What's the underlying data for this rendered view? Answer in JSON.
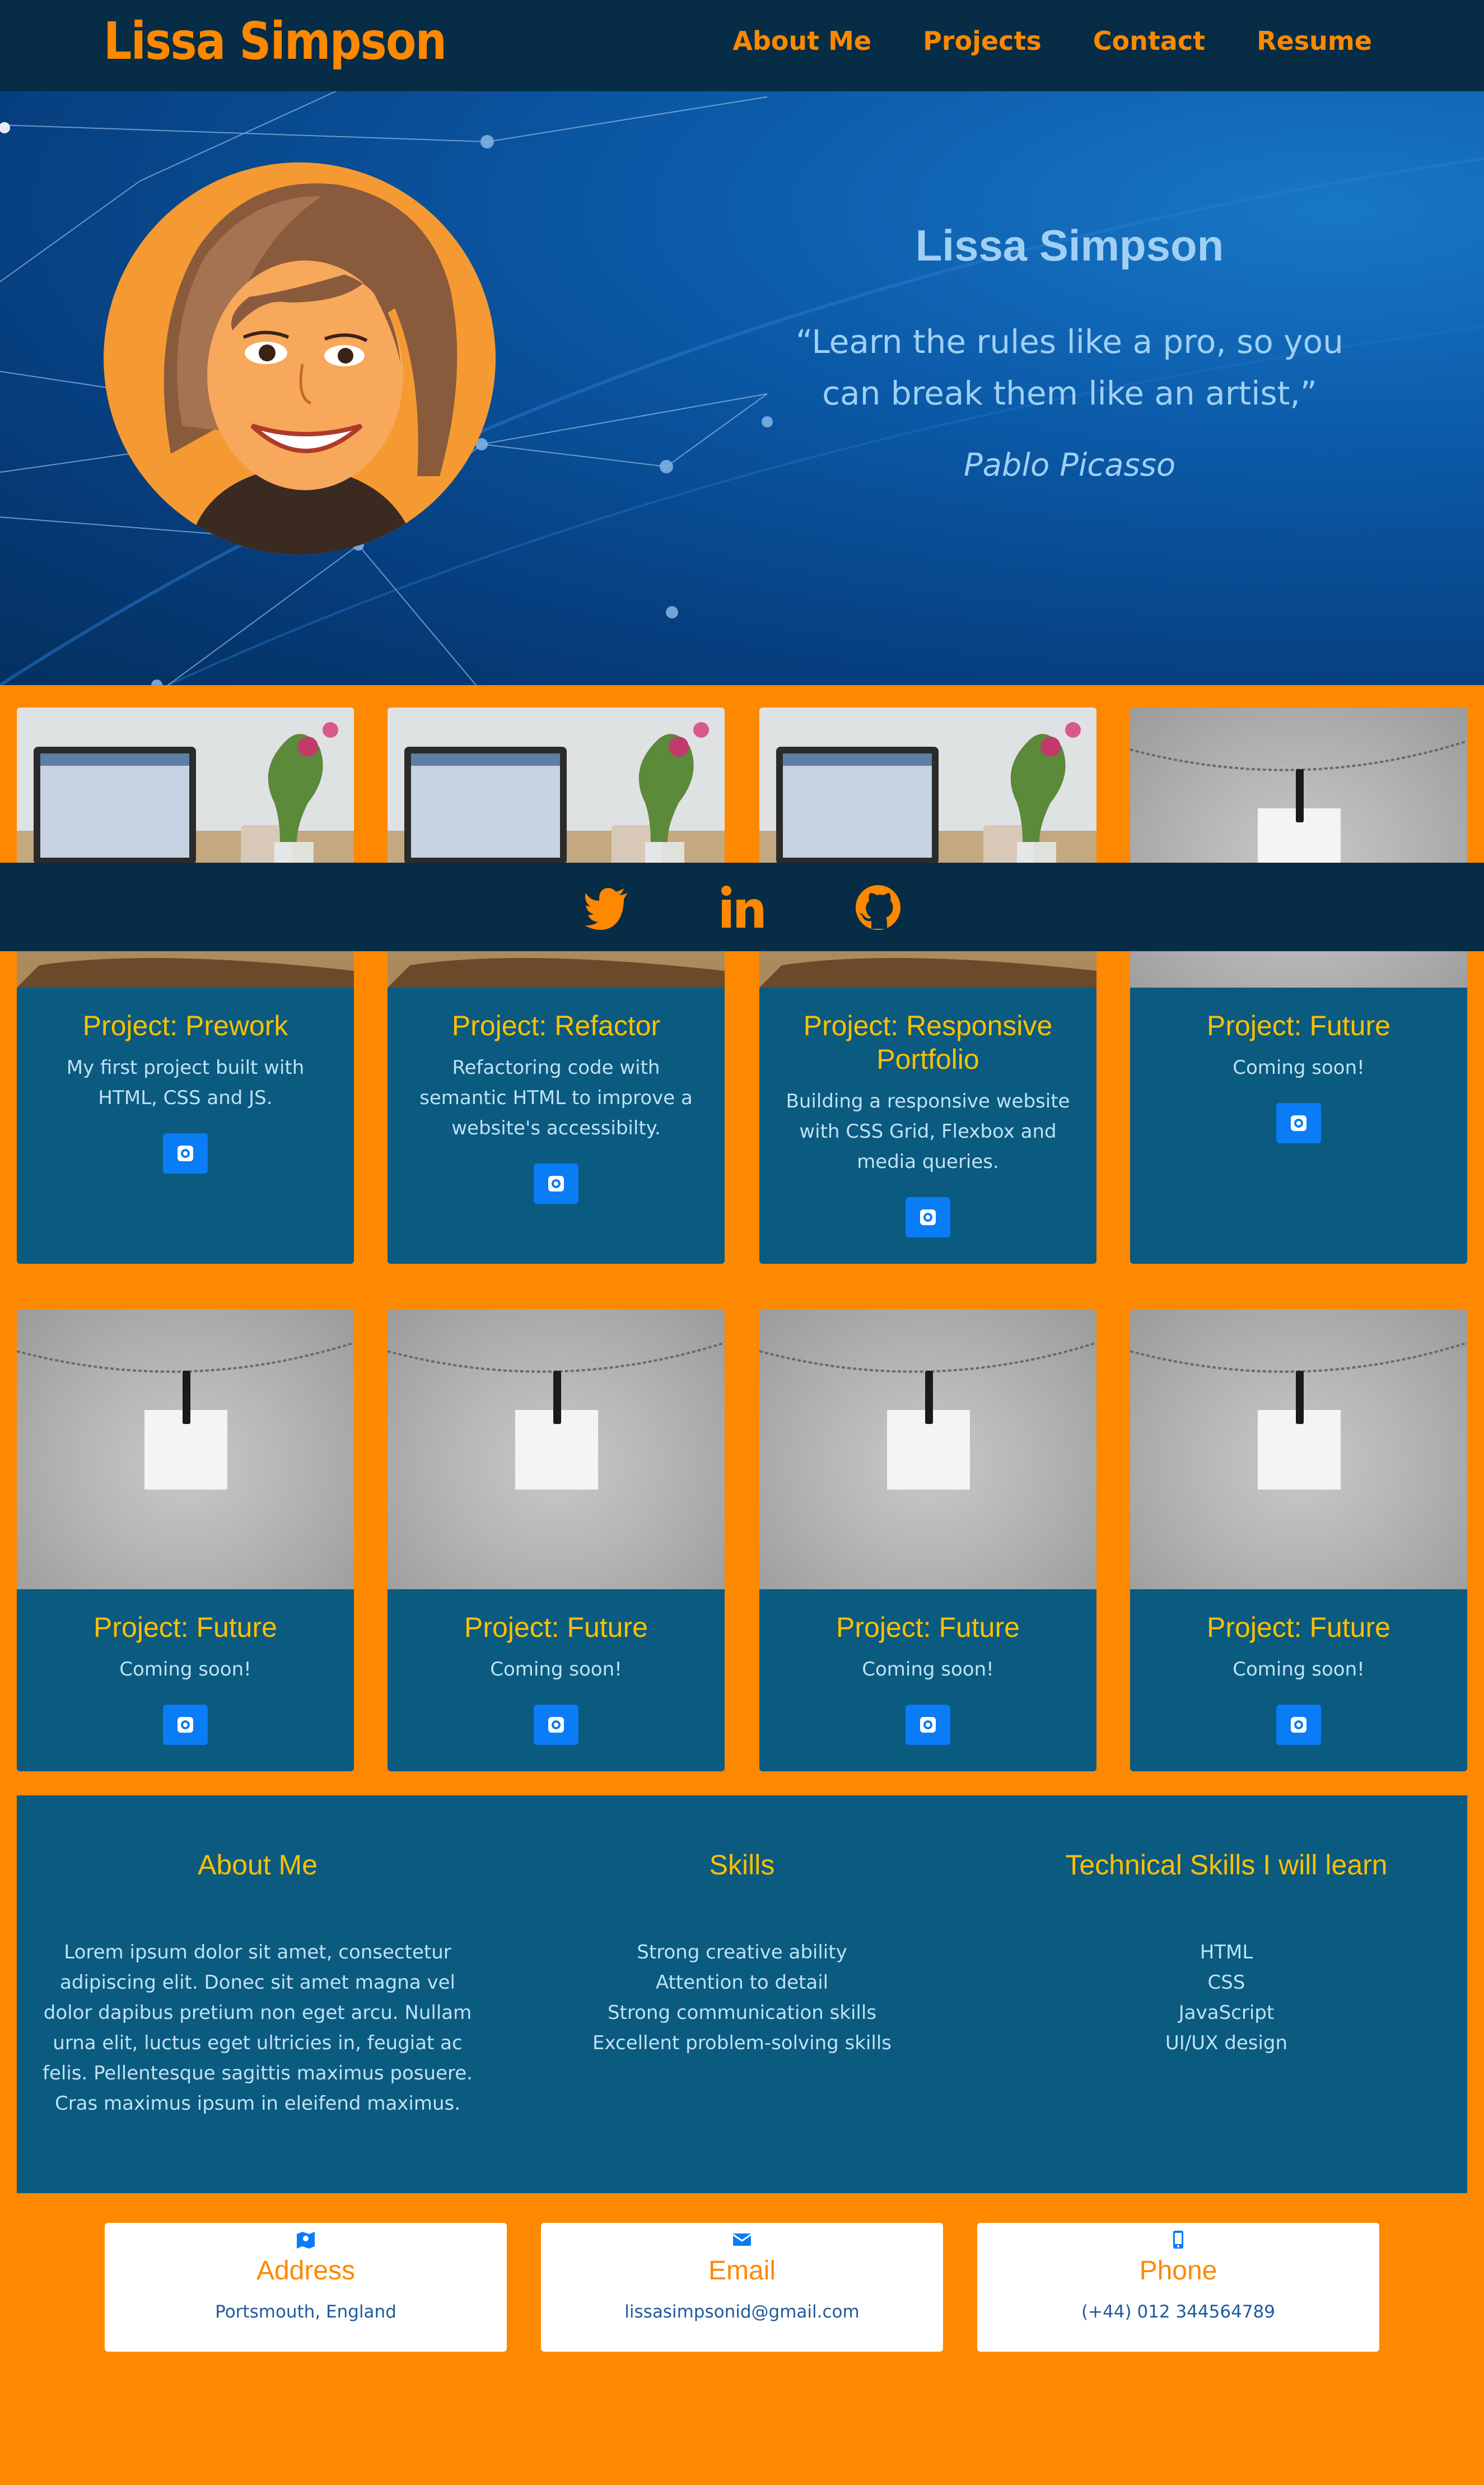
{
  "nav": {
    "brand": "Lissa Simpson",
    "links": [
      "About Me",
      "Projects",
      "Contact",
      "Resume"
    ]
  },
  "hero": {
    "name": "Lissa Simpson",
    "quote": "“Learn the rules like a pro, so you can break them like an artist,”",
    "author": "Pablo Picasso"
  },
  "projects": [
    {
      "title": "Project: Prework",
      "desc": "My first project built with HTML, CSS and JS.",
      "image": "laptop-desk"
    },
    {
      "title": "Project: Refactor",
      "desc": "Refactoring code with semantic HTML to improve a website's accessibilty.",
      "image": "laptop-desk"
    },
    {
      "title": "Project: Responsive Portfolio",
      "desc": "Building a responsive website with CSS Grid, Flexbox and media queries.",
      "image": "laptop-desk"
    },
    {
      "title": "Project: Future",
      "desc": "Coming soon!",
      "image": "paper-clip"
    },
    {
      "title": "Project: Future",
      "desc": "Coming soon!",
      "image": "paper-clip"
    },
    {
      "title": "Project: Future",
      "desc": "Coming soon!",
      "image": "paper-clip"
    },
    {
      "title": "Project: Future",
      "desc": "Coming soon!",
      "image": "paper-clip"
    },
    {
      "title": "Project: Future",
      "desc": "Coming soon!",
      "image": "paper-clip"
    }
  ],
  "social": [
    "twitter-icon",
    "linkedin-icon",
    "github-icon"
  ],
  "about": {
    "about_title": "About Me",
    "about_text": "Lorem ipsum dolor sit amet, consectetur adipiscing elit. Donec sit amet magna vel dolor dapibus pretium non eget arcu. Nullam urna elit, luctus eget ultricies in, feugiat ac felis. Pellentesque sagittis maximus posuere. Cras maximus ipsum in eleifend maximus.",
    "skills_title": "Skills",
    "skills": [
      "Strong creative ability",
      "Attention to detail",
      "Strong communication skills",
      "Excellent problem-solving skills"
    ],
    "tech_title": "Technical Skills I will learn",
    "tech": [
      "HTML",
      "CSS",
      "JavaScript",
      "UI/UX design"
    ]
  },
  "contact": [
    {
      "label": "Address",
      "value": "Portsmouth, England",
      "icon": "map-icon"
    },
    {
      "label": "Email",
      "value": "lissasimpsonid@gmail.com",
      "icon": "envelope-icon"
    },
    {
      "label": "Phone",
      "value": "(+44) 012 344564789",
      "icon": "mobile-icon"
    }
  ],
  "colors": {
    "orange": "#fe8800",
    "navy": "#062d45",
    "card": "#0b5a80",
    "gold": "#fcc000",
    "button": "#0a7cf5"
  }
}
